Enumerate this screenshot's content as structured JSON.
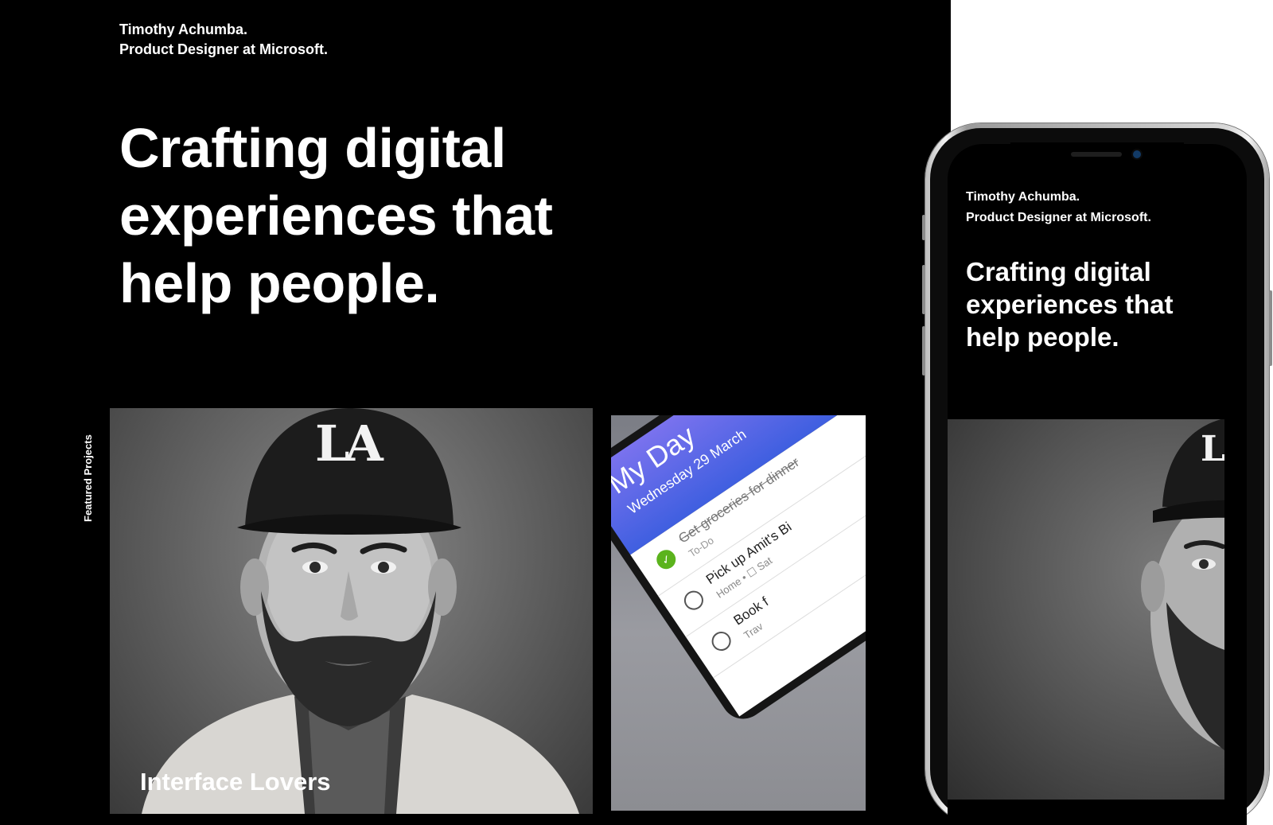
{
  "site": {
    "intro_name": "Timothy Achumba.",
    "intro_role": "Product Designer at Microsoft.",
    "hero_line1": "Crafting digital",
    "hero_line2": "experiences that",
    "hero_line3": "help people.",
    "featured_label": "Featured Projects"
  },
  "projects": [
    {
      "caption": "Interface Lovers",
      "cap_logo": "LA"
    },
    {
      "app_title": "My Day",
      "app_date": "Wednesday 29 March",
      "tasks": [
        {
          "title": "Get groceries for dinner",
          "list": "To-Do",
          "done": true
        },
        {
          "title": "Pick up Amit's Bi",
          "list": "Home • ☐ Sat",
          "done": false
        },
        {
          "title": "Book f",
          "list": "Trav",
          "done": false
        }
      ]
    }
  ],
  "phone": {
    "intro_name": "Timothy Achumba.",
    "intro_role": "Product Designer at Microsoft.",
    "hero_line1": "Crafting digital",
    "hero_line2": "experiences that",
    "hero_line3": "help people.",
    "cap_logo": "LA"
  },
  "colors": {
    "background": "#000000",
    "text": "#ffffff",
    "app_gradient_start": "#7a72ee",
    "app_gradient_end": "#3f5fe0",
    "check_green": "#5bb31d"
  }
}
